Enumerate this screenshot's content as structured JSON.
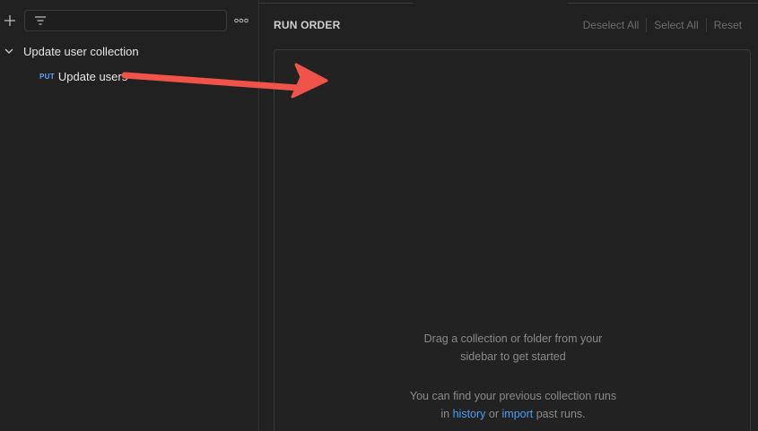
{
  "sidebar": {
    "add_icon": "plus-icon",
    "filter_icon": "filter-icon",
    "more_icon": "more-horizontal-icon",
    "search": {
      "value": "",
      "placeholder": ""
    },
    "collection": {
      "name": "Update user collection",
      "expanded": true,
      "requests": [
        {
          "method": "PUT",
          "name": "Update users"
        }
      ]
    }
  },
  "main": {
    "run_order_title": "RUN ORDER",
    "actions": {
      "deselect_all": "Deselect All",
      "select_all": "Select All",
      "reset": "Reset"
    },
    "empty_state": {
      "line1": "Drag a collection or folder from your",
      "line2": "sidebar to get started",
      "line3": "You can find your previous collection runs",
      "line4_prefix": "in",
      "history_link": "history",
      "or_text": "or",
      "import_link": "import",
      "line4_suffix": "past runs."
    }
  },
  "colors": {
    "background": "#212121",
    "method_put": "#5ea7f7",
    "link": "#4a9ef5",
    "annotation_arrow": "#f0534a"
  }
}
